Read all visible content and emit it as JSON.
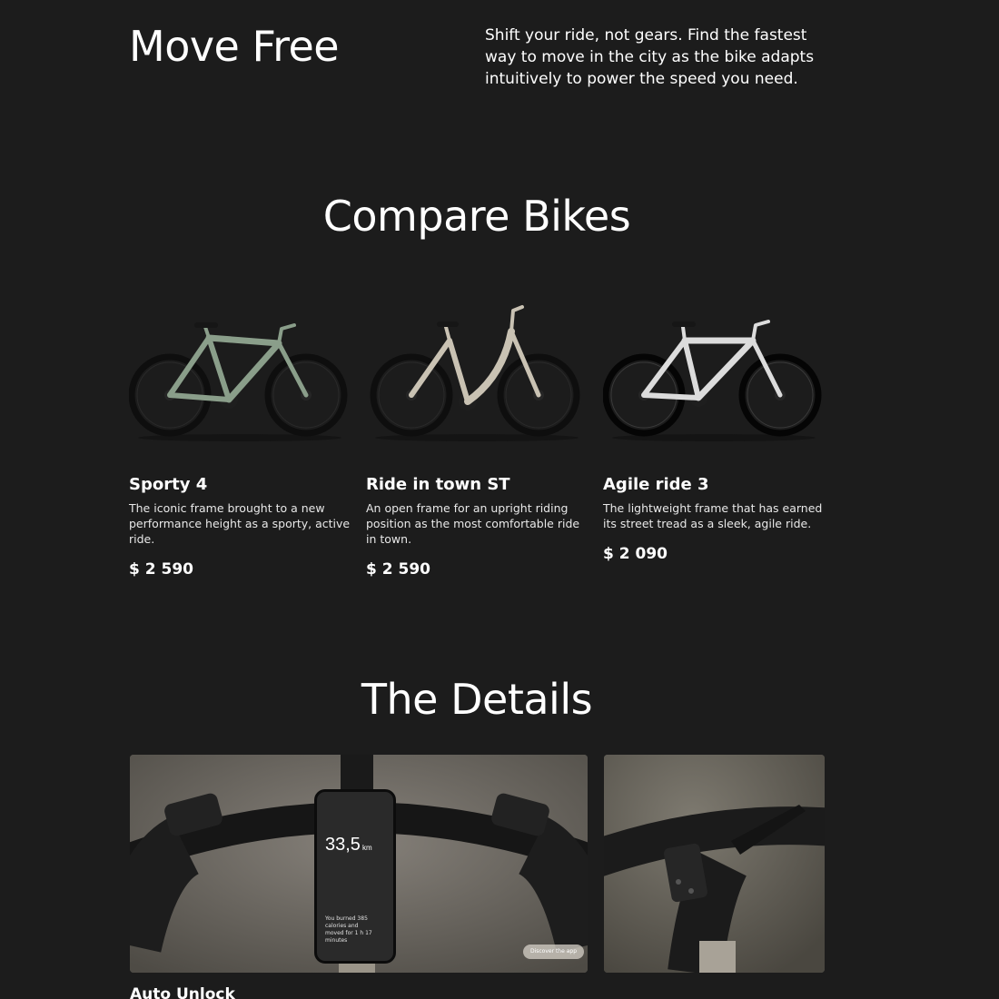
{
  "hero": {
    "title": "Move Free",
    "text": "Shift your ride, not gears. Find the fastest way to move in the city as the bike adapts intuitively to power the speed you need."
  },
  "compare": {
    "title": "Compare Bikes",
    "bikes": [
      {
        "name": "Sporty 4",
        "description": "The iconic frame brought to a new performance height as a sporty, active ride.",
        "price": "$ 2 590",
        "frame_color": "#8a9e8a"
      },
      {
        "name": "Ride in town ST",
        "description": "An open frame for an upright riding position as the most comfortable ride in town.",
        "price": "$ 2 590",
        "frame_color": "#c9c2b3"
      },
      {
        "name": "Agile ride 3",
        "description": "The lightweight frame that has earned its street tread as a sleek, agile ride.",
        "price": "$ 2 090",
        "frame_color": "#dcdcdc"
      }
    ]
  },
  "details": {
    "title": "The Details",
    "phone": {
      "distance_value": "33,5",
      "distance_unit": "km",
      "summary": "You burned 385 calories and moved for 1 h 17 minutes"
    },
    "app_button": "Discover the app",
    "caption": "Auto Unlock"
  }
}
